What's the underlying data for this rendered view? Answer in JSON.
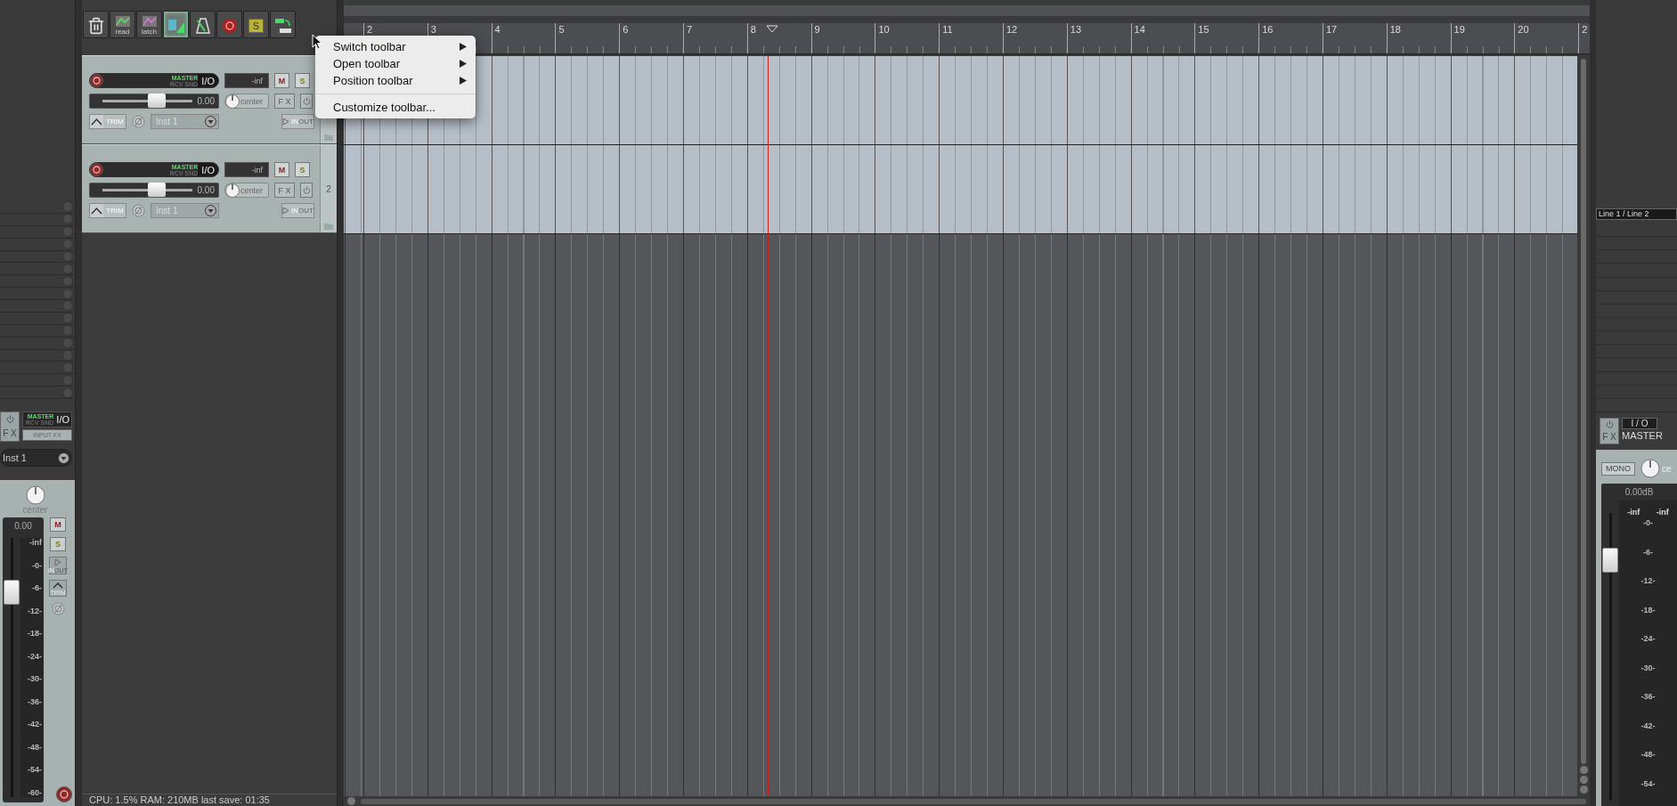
{
  "toolbar": {
    "buttons": [
      {
        "kind": "trash",
        "selected": false
      },
      {
        "kind": "envelope",
        "label": "read",
        "selected": false
      },
      {
        "kind": "envelope",
        "label": "latch",
        "selected": false
      },
      {
        "kind": "snap",
        "selected": true
      },
      {
        "kind": "metronome",
        "selected": false
      },
      {
        "kind": "record",
        "selected": false
      },
      {
        "kind": "solo",
        "label": "S",
        "selected": false
      },
      {
        "kind": "swap",
        "selected": false
      }
    ]
  },
  "context_menu": {
    "items": [
      {
        "kind": "item",
        "label": "Switch toolbar",
        "submenu": true
      },
      {
        "kind": "item",
        "label": "Open toolbar",
        "submenu": true
      },
      {
        "kind": "item",
        "label": "Position toolbar",
        "submenu": true
      },
      {
        "kind": "separator"
      },
      {
        "kind": "item",
        "label": "Customize toolbar...",
        "submenu": false
      }
    ]
  },
  "tracks": [
    {
      "routing_top": "MASTER",
      "routing_bottom": "RCV SND",
      "io": "I/O",
      "meter": "-inf",
      "mute": "M",
      "solo": "S",
      "volume": "0.00",
      "level": 0.61,
      "pan": "center",
      "fx": "F X",
      "trim": "TRIM",
      "input": "Inst 1",
      "monitor_in": "IN",
      "monitor_out": "OUT"
    },
    {
      "number": "2",
      "routing_top": "MASTER",
      "routing_bottom": "RCV SND",
      "io": "I/O",
      "meter": "-inf",
      "mute": "M",
      "solo": "S",
      "volume": "0.00",
      "level": 0.61,
      "pan": "center",
      "fx": "F X",
      "trim": "TRIM",
      "input": "Inst 1",
      "monitor_in": "IN",
      "monitor_out": "OUT"
    }
  ],
  "ruler": {
    "marks": [
      "2",
      "3",
      "4",
      "5",
      "6",
      "7",
      "8",
      "9",
      "10",
      "11",
      "12",
      "13",
      "14",
      "15",
      "16",
      "17",
      "18",
      "19",
      "20",
      "2"
    ]
  },
  "playhead": {
    "level": 0.344
  },
  "mixer_strip": {
    "fx": "F X",
    "routing_top": "MASTER",
    "routing_bottom": "RCV SND",
    "io": "I/O",
    "input_fx": "INPUT FX",
    "input": "Inst 1",
    "pan": "center",
    "volume": "0.00",
    "level": 0.82,
    "peak": "-inf",
    "scale": [
      "-0-",
      "-6-",
      "-12-",
      "-18-",
      "-24-",
      "-30-",
      "-36-",
      "-42-",
      "-48-",
      "-54-",
      "-60-"
    ],
    "mute": "M",
    "solo": "S",
    "monitor_in": "IN",
    "monitor_out": "OUT",
    "trim": "TRIM"
  },
  "master_strip": {
    "outputs": "Line 1 / Line 2",
    "fx": "F X",
    "io": "I / O",
    "name": "MASTER",
    "mono": "MONO",
    "pan": "ce",
    "volume": "0.00dB",
    "level": 0.82,
    "peaks": [
      "-inf",
      "-inf"
    ],
    "scale": [
      "-0-",
      "-6-",
      "-12-",
      "-18-",
      "-24-",
      "-30-",
      "-36-",
      "-42-",
      "-48-",
      "-54-"
    ]
  },
  "status_bar": "CPU: 1.5%  RAM: 210MB  last save: 01:35"
}
